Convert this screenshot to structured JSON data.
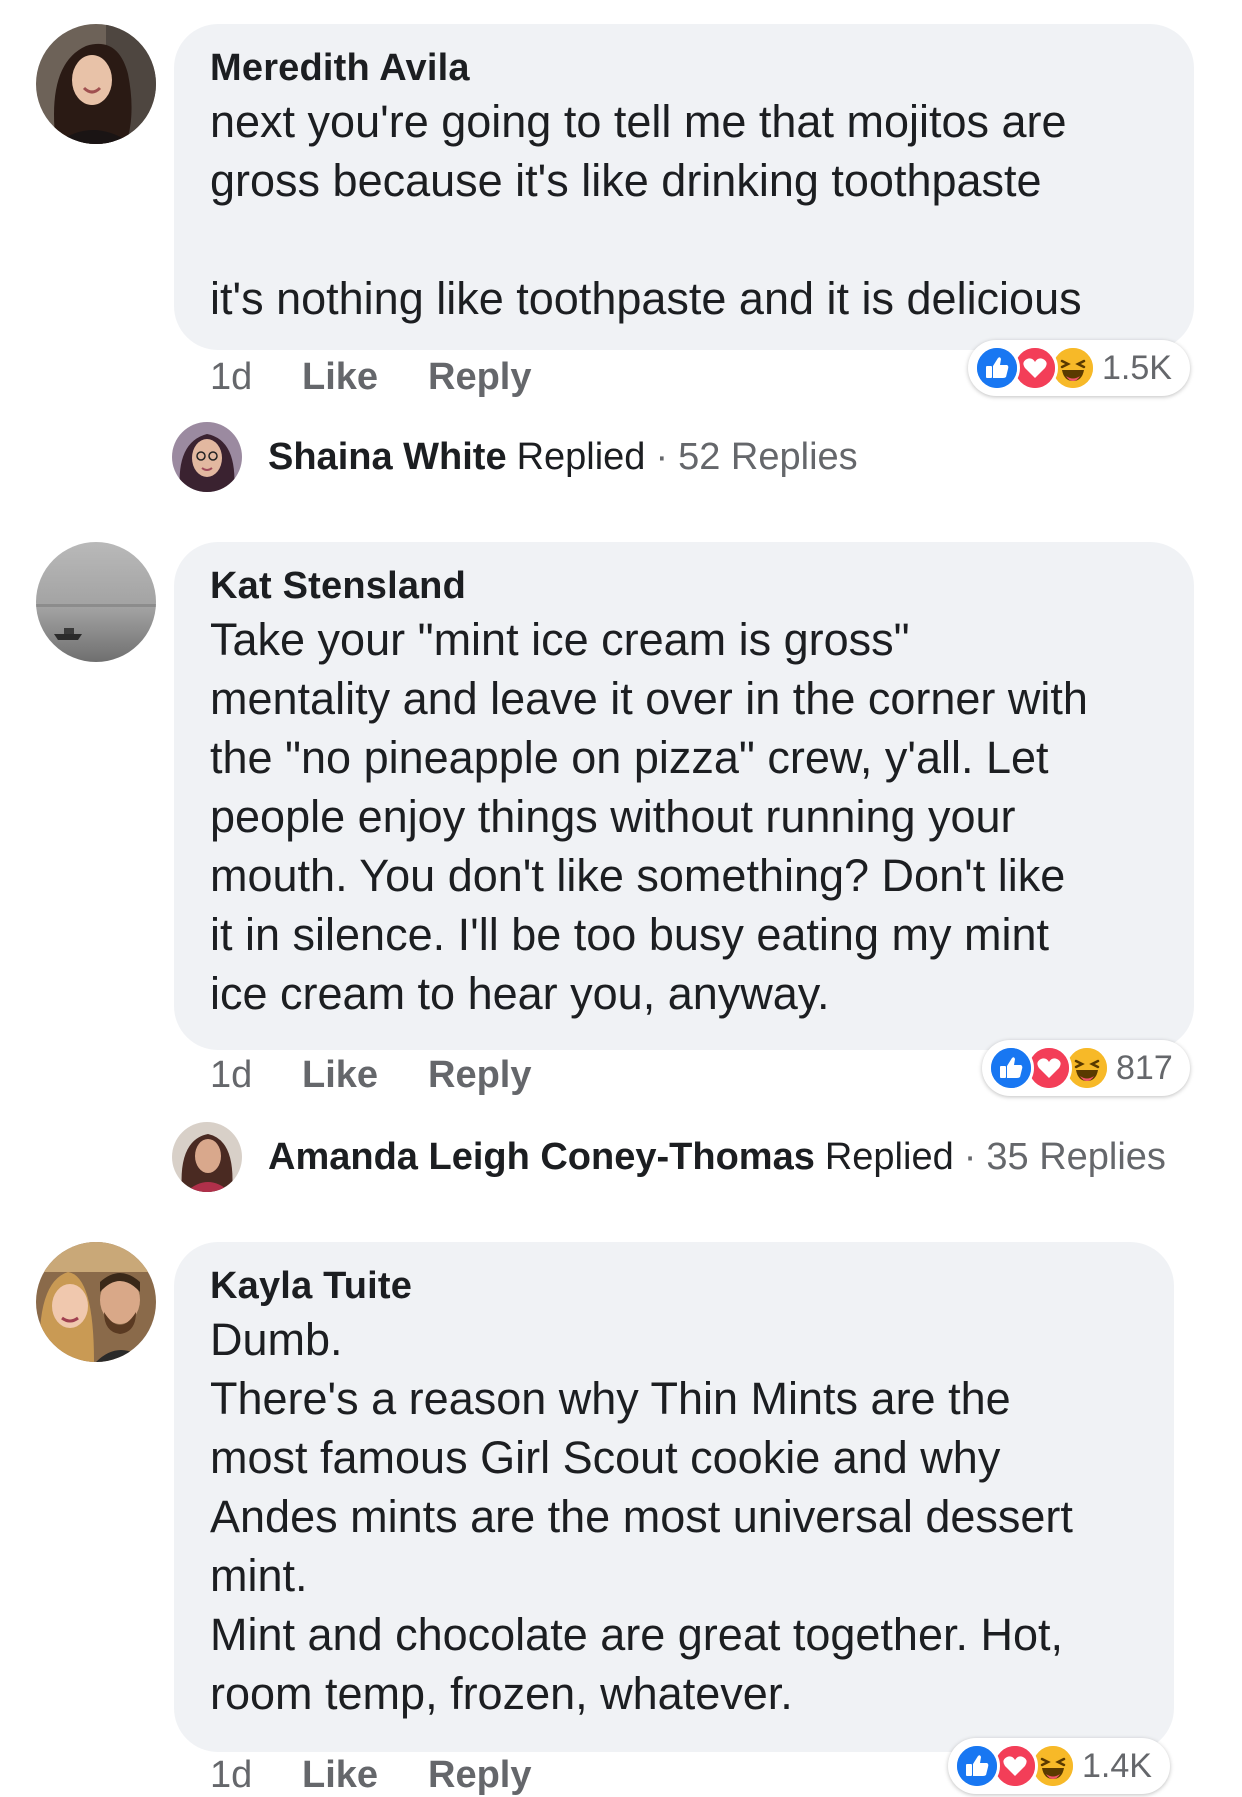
{
  "comments": [
    {
      "author": "Meredith Avila",
      "text": "next you're going to tell me that mojitos are\ngross because it's like drinking toothpaste\n\nit's nothing like toothpaste and it is delicious",
      "time": "1d",
      "like_label": "Like",
      "reply_label": "Reply",
      "reaction_count": "1.5K",
      "reply_summary": {
        "name": "Shaina White",
        "verb": "Replied",
        "separator": "·",
        "count": "52 Replies"
      }
    },
    {
      "author": "Kat Stensland",
      "text": "Take your \"mint ice cream is gross\"\nmentality and leave it over in the corner with\nthe \"no pineapple on pizza\" crew, y'all. Let\npeople enjoy things without running your\nmouth. You don't like something? Don't like\nit in silence. I'll be too busy eating my mint\nice cream to hear you, anyway.",
      "time": "1d",
      "like_label": "Like",
      "reply_label": "Reply",
      "reaction_count": "817",
      "reply_summary": {
        "name": "Amanda Leigh Coney-Thomas",
        "verb": "Replied",
        "separator": "·",
        "count": "35 Replies"
      }
    },
    {
      "author": "Kayla Tuite",
      "text": "Dumb.\nThere's a reason why Thin Mints are the\nmost famous Girl Scout cookie and why\nAndes mints are the most universal dessert\nmint.\nMint and chocolate are great together. Hot,\nroom temp, frozen, whatever.",
      "time": "1d",
      "like_label": "Like",
      "reply_label": "Reply",
      "reaction_count": "1.4K"
    }
  ],
  "reaction_icons": [
    "like-reaction-icon",
    "love-reaction-icon",
    "haha-reaction-icon"
  ],
  "colors": {
    "bubble": "#f0f2f5",
    "muted_text": "#65676b",
    "like": "#1877f2",
    "love": "#f33e58",
    "haha": "#f7b928"
  }
}
